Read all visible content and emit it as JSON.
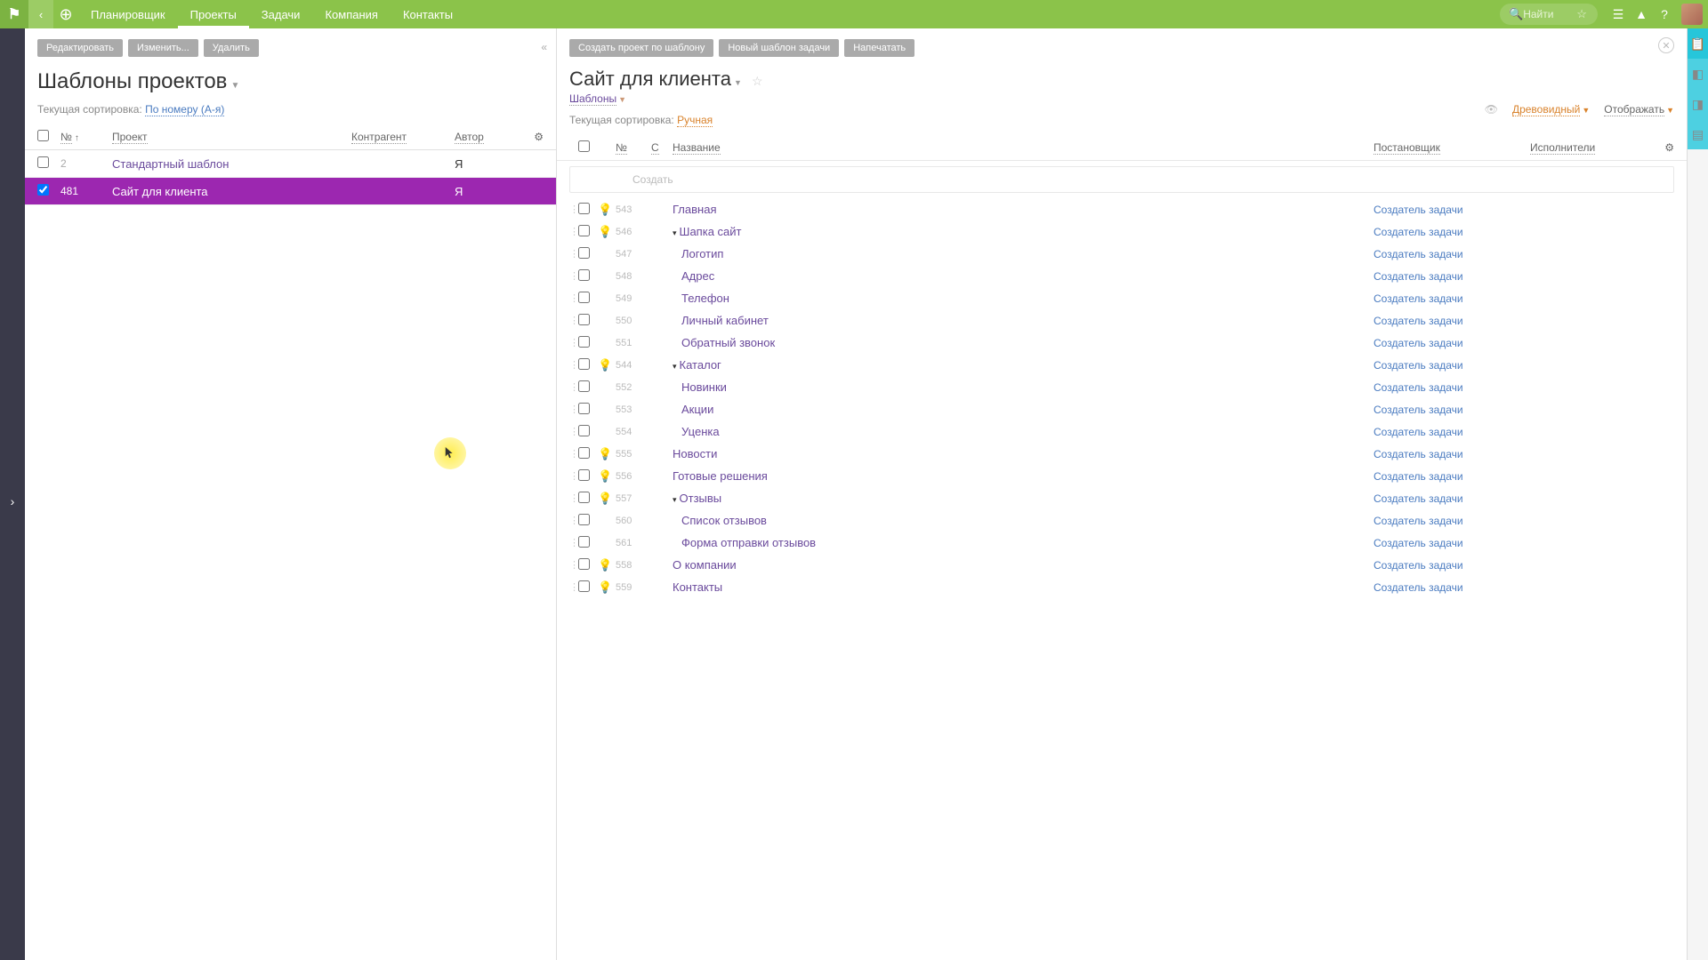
{
  "nav": {
    "items": [
      "Планировщик",
      "Проекты",
      "Задачи",
      "Компания",
      "Контакты"
    ],
    "active_index": 1,
    "search_placeholder": "Найти"
  },
  "left": {
    "buttons": [
      "Редактировать",
      "Изменить...",
      "Удалить"
    ],
    "title": "Шаблоны проектов",
    "sort_label": "Текущая сортировка:",
    "sort_value": "По номеру (А-я)",
    "columns": {
      "num": "№",
      "project": "Проект",
      "contra": "Контрагент",
      "author": "Автор"
    },
    "rows": [
      {
        "num": "2",
        "project": "Стандартный шаблон",
        "contra": "",
        "author": "Я",
        "selected": false,
        "checked": false
      },
      {
        "num": "481",
        "project": "Сайт для клиента",
        "contra": "",
        "author": "Я",
        "selected": true,
        "checked": true
      }
    ]
  },
  "right": {
    "buttons": [
      "Создать проект по шаблону",
      "Новый шаблон задачи",
      "Напечатать"
    ],
    "title": "Сайт для клиента",
    "breadcrumb": "Шаблоны",
    "view_mode": "Древовидный",
    "display_label": "Отображать",
    "sort_label": "Текущая сортировка:",
    "sort_value": "Ручная",
    "columns": {
      "num": "№",
      "c": "С",
      "name": "Название",
      "post": "Постановщик",
      "exec": "Исполнители"
    },
    "create_placeholder": "Создать",
    "task_creator": "Создатель задачи",
    "tasks": [
      {
        "num": "543",
        "name": "Главная",
        "bulb": true,
        "expand": false,
        "indent": 0
      },
      {
        "num": "546",
        "name": "Шапка сайт",
        "bulb": true,
        "expand": true,
        "indent": 0
      },
      {
        "num": "547",
        "name": "Логотип",
        "bulb": false,
        "expand": false,
        "indent": 1
      },
      {
        "num": "548",
        "name": "Адрес",
        "bulb": false,
        "expand": false,
        "indent": 1
      },
      {
        "num": "549",
        "name": "Телефон",
        "bulb": false,
        "expand": false,
        "indent": 1
      },
      {
        "num": "550",
        "name": "Личный кабинет",
        "bulb": false,
        "expand": false,
        "indent": 1
      },
      {
        "num": "551",
        "name": "Обратный звонок",
        "bulb": false,
        "expand": false,
        "indent": 1
      },
      {
        "num": "544",
        "name": "Каталог",
        "bulb": true,
        "expand": true,
        "indent": 0
      },
      {
        "num": "552",
        "name": "Новинки",
        "bulb": false,
        "expand": false,
        "indent": 1
      },
      {
        "num": "553",
        "name": "Акции",
        "bulb": false,
        "expand": false,
        "indent": 1
      },
      {
        "num": "554",
        "name": "Уценка",
        "bulb": false,
        "expand": false,
        "indent": 1
      },
      {
        "num": "555",
        "name": "Новости",
        "bulb": true,
        "expand": false,
        "indent": 0
      },
      {
        "num": "556",
        "name": "Готовые решения",
        "bulb": true,
        "expand": false,
        "indent": 0
      },
      {
        "num": "557",
        "name": "Отзывы",
        "bulb": true,
        "expand": true,
        "indent": 0
      },
      {
        "num": "560",
        "name": "Список отзывов",
        "bulb": false,
        "expand": false,
        "indent": 1
      },
      {
        "num": "561",
        "name": "Форма отправки отзывов",
        "bulb": false,
        "expand": false,
        "indent": 1
      },
      {
        "num": "558",
        "name": "О компании",
        "bulb": true,
        "expand": false,
        "indent": 0
      },
      {
        "num": "559",
        "name": "Контакты",
        "bulb": true,
        "expand": false,
        "indent": 0
      }
    ]
  }
}
